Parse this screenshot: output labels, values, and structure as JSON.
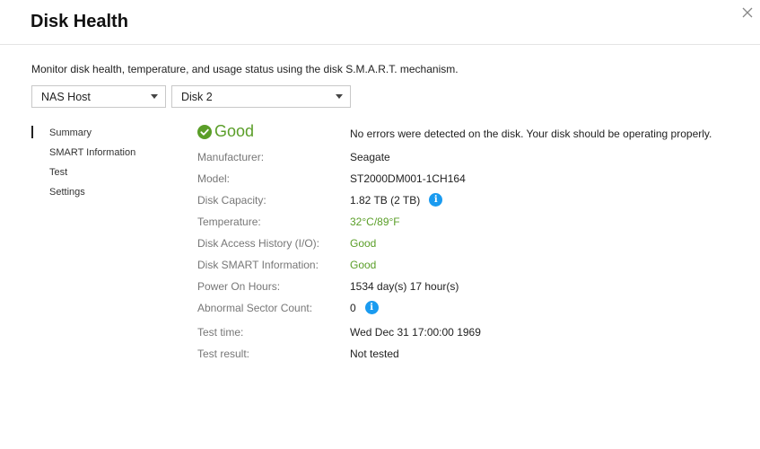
{
  "dialog": {
    "title": "Disk Health"
  },
  "description": "Monitor disk health, temperature, and usage status using the disk S.M.A.R.T. mechanism.",
  "selectors": {
    "host": "NAS Host",
    "disk": "Disk 2"
  },
  "nav": [
    "Summary",
    "SMART Information",
    "Test",
    "Settings"
  ],
  "status": {
    "label": "Good",
    "message": "No errors were detected on the disk. Your disk should be operating properly."
  },
  "details": {
    "manufacturer": {
      "label": "Manufacturer:",
      "value": "Seagate"
    },
    "model": {
      "label": "Model:",
      "value": "ST2000DM001-1CH164"
    },
    "capacity": {
      "label": "Disk Capacity:",
      "value": "1.82 TB (2 TB)"
    },
    "temperature": {
      "label": "Temperature:",
      "value": "32°C/89°F"
    },
    "access_history": {
      "label": "Disk Access History (I/O):",
      "value": "Good"
    },
    "smart_info": {
      "label": "Disk SMART Information:",
      "value": "Good"
    },
    "power_on_hours": {
      "label": "Power On Hours:",
      "value": "1534 day(s) 17 hour(s)"
    },
    "abnormal_sectors": {
      "label": "Abnormal Sector Count:",
      "value": "0"
    },
    "test_time": {
      "label": "Test time:",
      "value": "Wed Dec 31 17:00:00 1969"
    },
    "test_result": {
      "label": "Test result:",
      "value": "Not tested"
    }
  },
  "colors": {
    "good": "#5a9e28",
    "info": "#1a9bf0"
  },
  "icons": {
    "status": "check-circle-icon",
    "info": "info-icon",
    "close": "close-icon"
  }
}
